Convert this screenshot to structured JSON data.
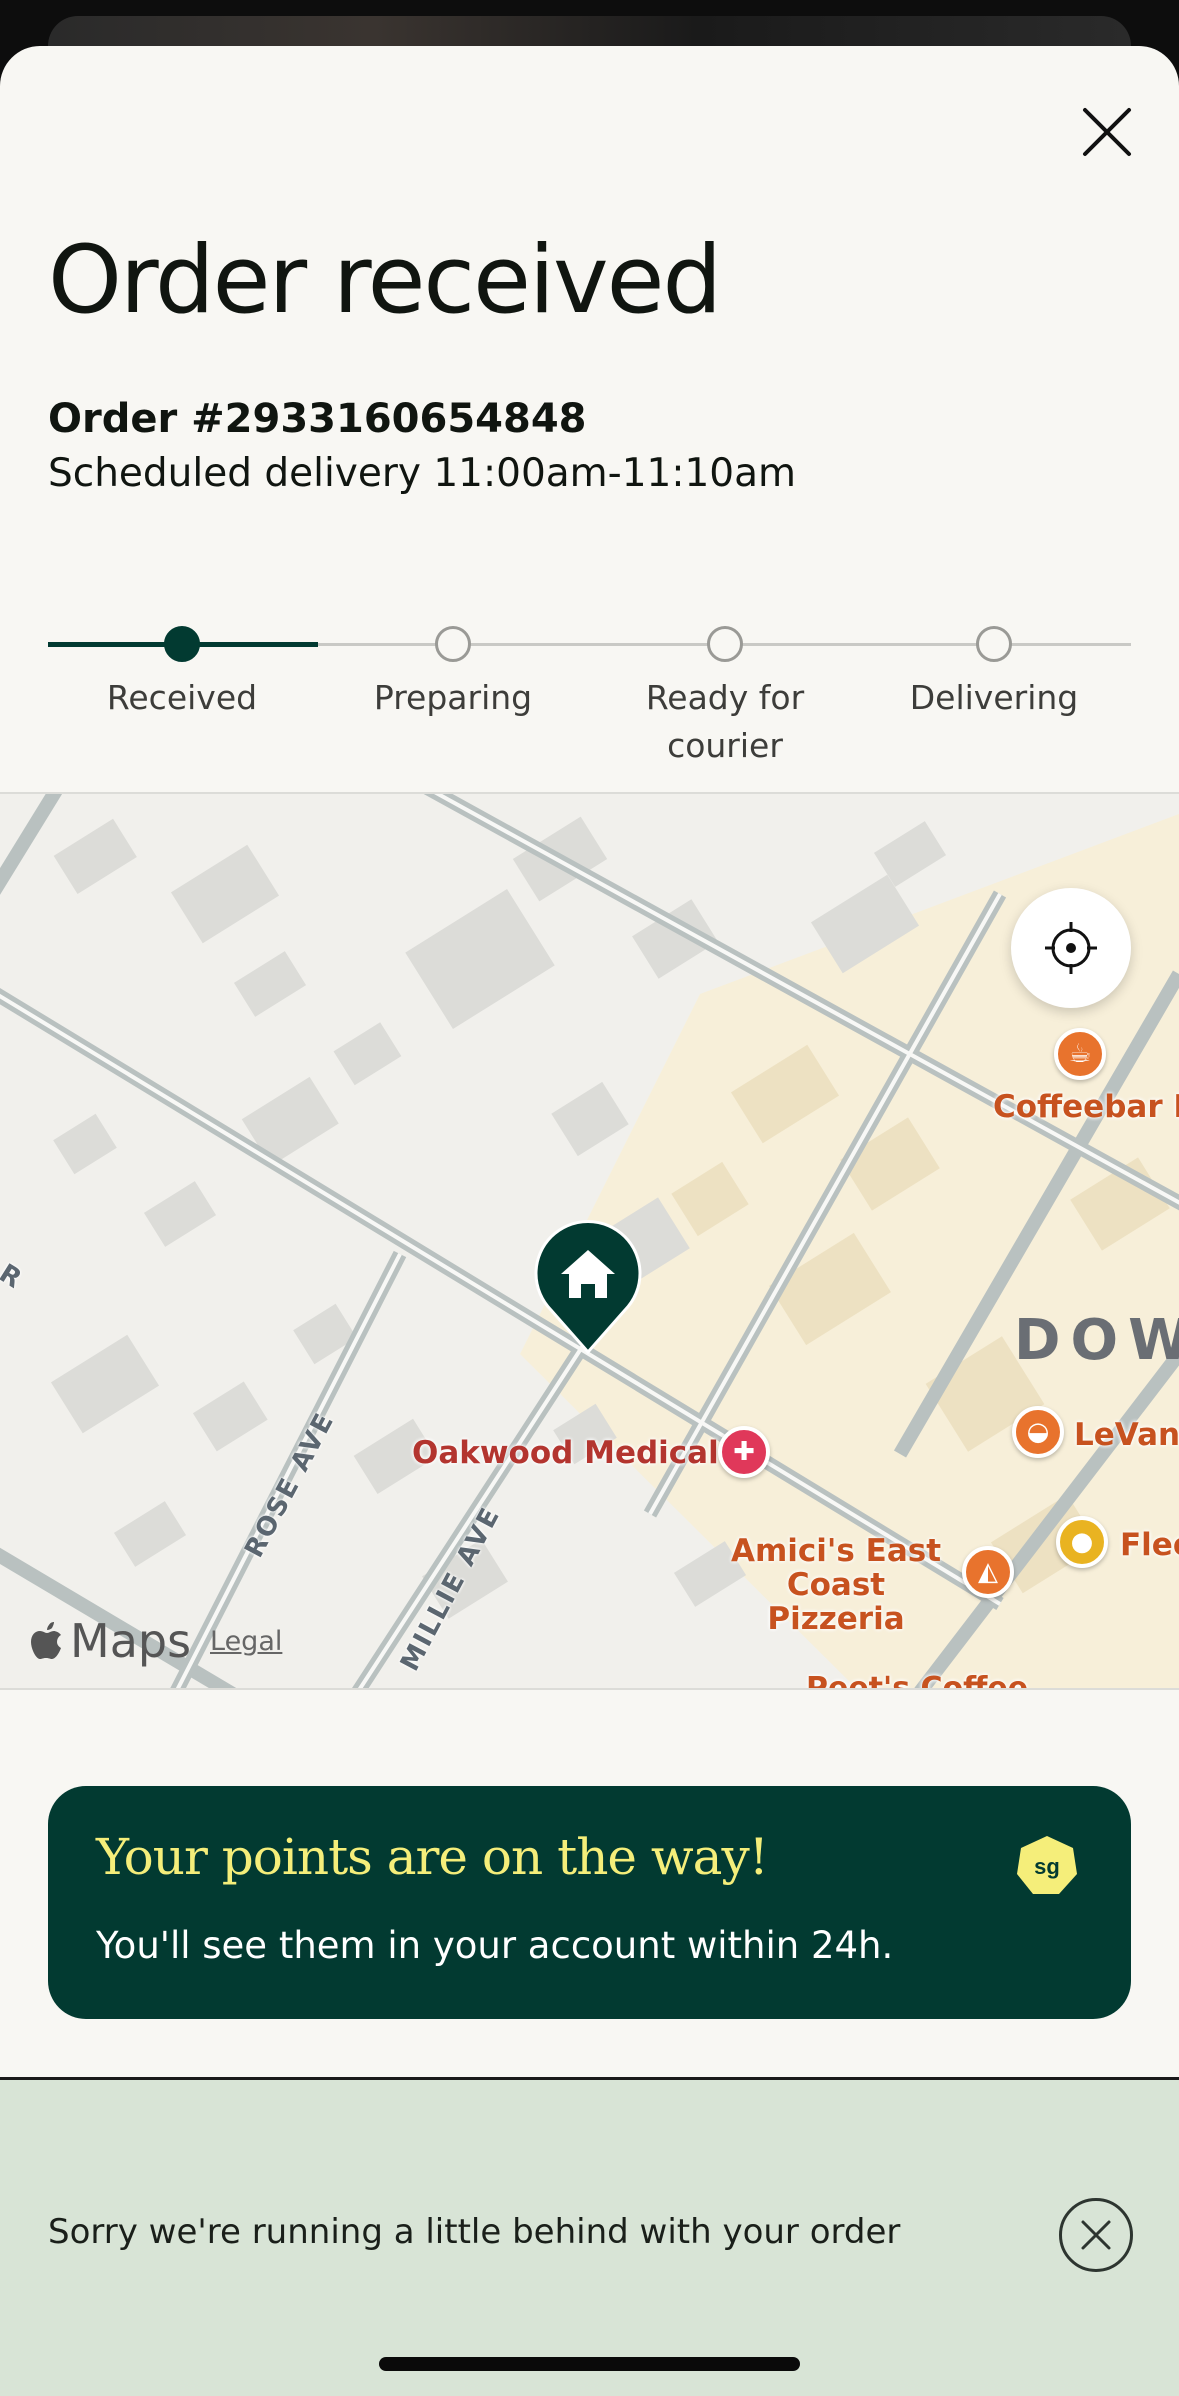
{
  "header": {
    "title": "Order received",
    "order_number": "Order #2933160654848",
    "schedule": "Scheduled delivery 11:00am-11:10am"
  },
  "progress": {
    "current_step": 0,
    "steps": [
      {
        "label": "Received"
      },
      {
        "label": "Preparing"
      },
      {
        "label": "Ready for courier"
      },
      {
        "label": "Delivering"
      }
    ]
  },
  "map": {
    "brand": "Maps",
    "legal": "Legal",
    "places": {
      "coffeebar": "Coffeebar Downtown",
      "oakwood": "Oakwood Medical",
      "levant": "LeVant",
      "fleet": "Flee",
      "amici": "Amici's East Coast Pizzeria",
      "peets": "Peet's Coffee"
    },
    "streets": {
      "rose": "ROSE AVE",
      "millie": "MILLIE AVE",
      "edge": "R"
    },
    "district": "DOWN",
    "icons": {
      "locate": "locate-crosshair-icon",
      "home": "home-pin-icon"
    }
  },
  "points_card": {
    "title": "Your points are on the way!",
    "subtitle": "You'll see them in your account within 24h.",
    "badge": "sg"
  },
  "banner": {
    "message": "Sorry we're running a little behind with your order"
  },
  "colors": {
    "brand_dark": "#023a31",
    "accent_yellow": "#f5ee7a",
    "banner_bg": "#d8e4d6",
    "sheet_bg": "#f8f7f3"
  }
}
